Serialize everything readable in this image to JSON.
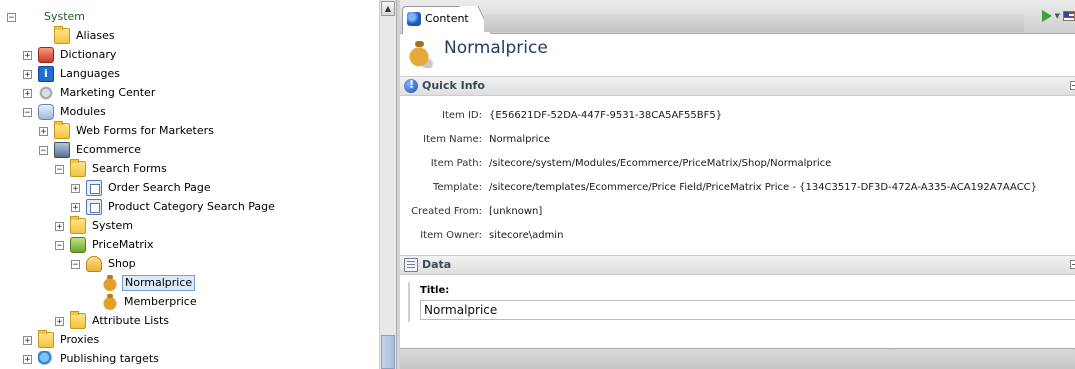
{
  "tree": {
    "expand_plus": "+",
    "expand_minus": "−",
    "items": [
      {
        "label": "System",
        "icon": "system-icon",
        "state": "expanded",
        "kind": "system"
      },
      {
        "label": "Aliases",
        "icon": "folder-icon",
        "state": "none",
        "kind": "folder"
      },
      {
        "label": "Dictionary",
        "icon": "dictionary-icon",
        "state": "collapsed",
        "kind": "dict"
      },
      {
        "label": "Languages",
        "icon": "languages-icon",
        "state": "collapsed",
        "kind": "lang"
      },
      {
        "label": "Marketing Center",
        "icon": "marketing-center-icon",
        "state": "collapsed",
        "kind": "mkt"
      },
      {
        "label": "Modules",
        "icon": "modules-icon",
        "state": "expanded",
        "kind": "mods"
      },
      {
        "label": "Web Forms for Marketers",
        "icon": "folder-icon",
        "state": "collapsed",
        "kind": "folder"
      },
      {
        "label": "Ecommerce",
        "icon": "ecommerce-icon",
        "state": "expanded",
        "kind": "ecom"
      },
      {
        "label": "Search Forms",
        "icon": "folder-icon",
        "state": "expanded",
        "kind": "folder"
      },
      {
        "label": "Order Search Page",
        "icon": "page-icon",
        "state": "collapsed",
        "kind": "page"
      },
      {
        "label": "Product Category Search Page",
        "icon": "page-icon",
        "state": "collapsed",
        "kind": "page"
      },
      {
        "label": "System",
        "icon": "folder-icon",
        "state": "collapsed",
        "kind": "folder"
      },
      {
        "label": "PriceMatrix",
        "icon": "price-matrix-icon",
        "state": "expanded",
        "kind": "pm"
      },
      {
        "label": "Shop",
        "icon": "shop-icon",
        "state": "expanded",
        "kind": "shop"
      },
      {
        "label": "Normalprice",
        "icon": "money-bag-icon",
        "state": "none",
        "kind": "bag"
      },
      {
        "label": "Memberprice",
        "icon": "money-bag-icon",
        "state": "none",
        "kind": "bag"
      },
      {
        "label": "Attribute Lists",
        "icon": "folder-icon",
        "state": "collapsed",
        "kind": "folder"
      },
      {
        "label": "Proxies",
        "icon": "folder-icon",
        "state": "collapsed",
        "kind": "folder"
      },
      {
        "label": "Publishing targets",
        "icon": "publishing-targets-icon",
        "state": "collapsed",
        "kind": "pub"
      }
    ],
    "selected_label": "Normalprice"
  },
  "scrollbar": {
    "up_arrow": "▲"
  },
  "tabs": [
    {
      "label": "Content",
      "icon": "content-tab-icon",
      "active": true
    }
  ],
  "tab_tools": {
    "dropdown_glyph": "▼"
  },
  "item": {
    "title": "Normalprice",
    "icon": "money-bag-icon"
  },
  "sections": {
    "quick_info": {
      "title": "Quick Info",
      "collapse_glyph": "−",
      "rows": [
        {
          "key": "Item ID:",
          "value": "{E56621DF-52DA-447F-9531-38CA5AF55BF5}"
        },
        {
          "key": "Item Name:",
          "value": "Normalprice"
        },
        {
          "key": "Item Path:",
          "value": "/sitecore/system/Modules/Ecommerce/PriceMatrix/Shop/Normalprice"
        },
        {
          "key": "Template:",
          "value": "/sitecore/templates/Ecommerce/Price Field/PriceMatrix Price - {134C3517-DF3D-472A-A335-ACA192A7AACC}"
        },
        {
          "key": "Created From:",
          "value": "[unknown]"
        },
        {
          "key": "Item Owner:",
          "value": "sitecore\\admin"
        }
      ]
    },
    "data": {
      "title": "Data",
      "collapse_glyph": "−",
      "fields": [
        {
          "label": "Title:",
          "value": "Normalprice"
        }
      ]
    }
  }
}
